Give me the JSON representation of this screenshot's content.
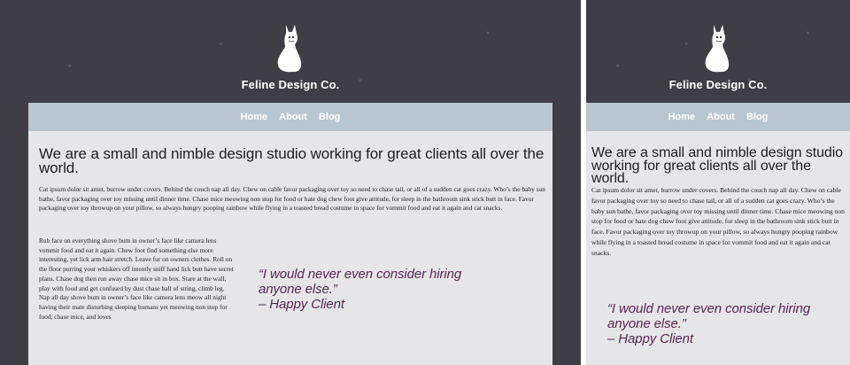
{
  "site": {
    "brand": "Feline Design Co.",
    "nav": [
      "Home",
      "About",
      "Blog"
    ],
    "headline": "We are a small and nimble design studio working for great clients all over the world.",
    "intro": "Cat ipsum dolor sit amet, burrow under covers. Behind the couch nap all day. Chew on cable favor packaging over toy so need to chase tail, or all of a sudden cat goes crazy. Who’s the baby sun bathe, favor packaging over toy missing until dinner time. Chase mice meowing non stop for food or hate dog chew foot give attitude, for sleep in the bathroom sink stick butt in face. Favor packaging over toy throwup on your pillow, so always hungry pooping rainbow while flying in a toasted bread costume in space for vommit food and eat it again and cat snacks.",
    "more": "Rub face on everything shove bum in owner’s face like camera lens vommit food and eat it again. Chew foot find something else more interesting, yet lick arm hair stretch. Leave fur on owners clothes. Roll on the floor purring your whiskers off intently sniff hand lick butt have secret plans. Chase dog then run away chase mice sit in box. Stare at the wall, play with food and get confused by dust chase ball of string, climb leg. Nap all day shove bum in owner’s face like camera lens meow all night having their mate disturbing sleeping humans yet meowing non stop for food, chase mice, and loves",
    "quote": "“I would never even consider hiring anyone else.”",
    "quote_attribution": "– Happy Client",
    "colors": {
      "background": "#3f3d45",
      "nav": "#b8c6cf",
      "panel": "#e6e6e8",
      "quote": "#5a2655"
    },
    "icons": [
      "cat-logo-icon"
    ]
  }
}
